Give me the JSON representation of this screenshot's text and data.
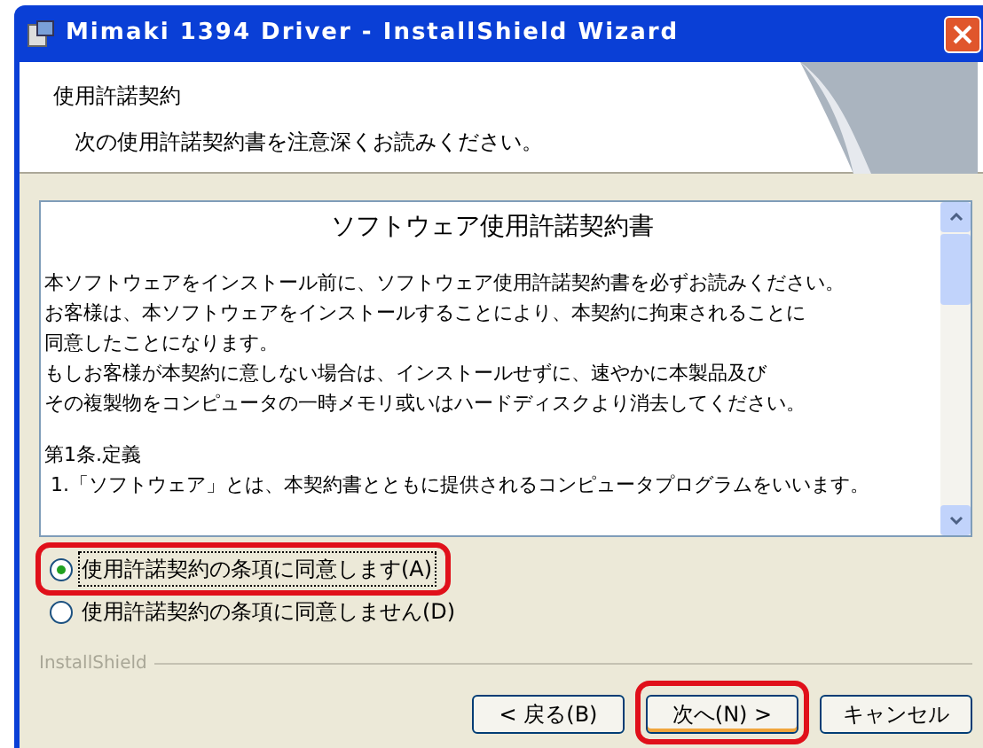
{
  "window": {
    "title": "Mimaki 1394 Driver - InstallShield Wizard"
  },
  "header": {
    "title": "使用許諾契約",
    "subtitle": "次の使用許諾契約書を注意深くお読みください。"
  },
  "license": {
    "heading": "ソフトウェア使用許諾契約書",
    "paragraphs": [
      "本ソフトウェアをインストール前に、ソフトウェア使用許諾契約書を必ずお読みください。",
      "お客様は、本ソフトウェアをインストールすることにより、本契約に拘束されることに",
      "同意したことになります。",
      "もしお客様が本契約に意しない場合は、インストールせずに、速やかに本製品及び",
      "その複製物をコンピュータの一時メモリ或いはハードディスクより消去してください。"
    ],
    "section_paragraphs": [
      "第1条.定義",
      " 1.「ソフトウェア」とは、本契約書とともに提供されるコンピュータプログラムをいいます。"
    ]
  },
  "options": [
    {
      "label": "使用許諾契約の条項に同意します(A)",
      "selected": true,
      "highlighted": true
    },
    {
      "label": "使用許諾契約の条項に同意しません(D)",
      "selected": false,
      "highlighted": false
    }
  ],
  "brand": "InstallShield",
  "buttons": [
    {
      "label": "< 戻る(B)",
      "highlighted": false,
      "default": false
    },
    {
      "label": "次へ(N) >",
      "highlighted": true,
      "default": true
    },
    {
      "label": "キャンセル",
      "highlighted": false,
      "default": false
    }
  ]
}
